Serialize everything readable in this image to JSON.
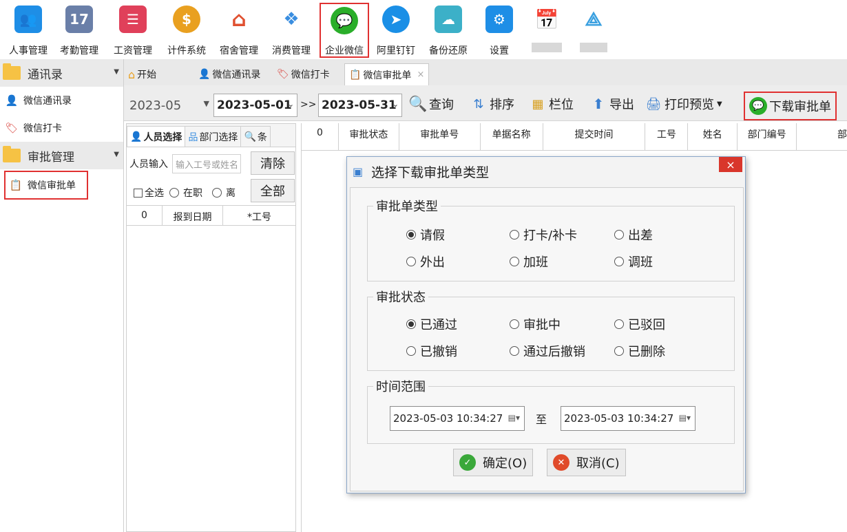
{
  "toolbar": {
    "items": [
      {
        "label": "人事管理",
        "icon": "people-icon",
        "color": "#1e8ee6"
      },
      {
        "label": "考勤管理",
        "icon": "calendar-icon",
        "color": "#6a7fa8"
      },
      {
        "label": "工资管理",
        "icon": "ledger-icon",
        "color": "#e0405a"
      },
      {
        "label": "计件系统",
        "icon": "money-bag-icon",
        "color": "#e9a020"
      },
      {
        "label": "宿舍管理",
        "icon": "house-gear-icon",
        "color": "#e05030"
      },
      {
        "label": "消费管理",
        "icon": "cubes-icon",
        "color": "#3a8ee0"
      },
      {
        "label": "企业微信",
        "icon": "wechat-icon",
        "color": "#2aae2a"
      },
      {
        "label": "阿里钉钉",
        "icon": "dingtalk-icon",
        "color": "#1a8fe6"
      },
      {
        "label": "备份还原",
        "icon": "cloud-icon",
        "color": "#3cb0c8"
      },
      {
        "label": "设置",
        "icon": "gear-icon",
        "color": "#1e8ee6"
      },
      {
        "label": "",
        "icon": "calendar-person-icon",
        "color": "#c43a3a"
      },
      {
        "label": "",
        "icon": "share-network-icon",
        "color": "#3aa0e0"
      }
    ]
  },
  "sidebar": {
    "groups": [
      {
        "label": "通讯录",
        "items": [
          {
            "label": "微信通讯录"
          },
          {
            "label": "微信打卡"
          }
        ]
      },
      {
        "label": "审批管理",
        "items": [
          {
            "label": "微信审批单"
          }
        ]
      }
    ]
  },
  "tabs": [
    {
      "label": "开始"
    },
    {
      "label": "微信通讯录"
    },
    {
      "label": "微信打卡"
    },
    {
      "label": "微信审批单",
      "close": "×"
    }
  ],
  "filter": {
    "month": "2023-05",
    "start_date": "2023-05-01",
    "range_sep": ">>",
    "end_date": "2023-05-31",
    "query": "查询",
    "sort": "排序",
    "columns": "栏位",
    "export": "导出",
    "print_preview": "打印预览",
    "download": "下载审批单"
  },
  "personnel": {
    "tabs": [
      "人员选择",
      "部门选择",
      "条"
    ],
    "input_label": "人员输入",
    "input_placeholder": "输入工号或姓名",
    "clear": "清除",
    "all_btn": "全部",
    "select_all": "全选",
    "status_active": "在职",
    "status_left": "离",
    "grid_headers": [
      "0",
      "报到日期",
      "*工号"
    ]
  },
  "grid": {
    "headers": [
      "0",
      "审批状态",
      "审批单号",
      "单据名称",
      "提交时间",
      "工号",
      "姓名",
      "部门编号",
      "部"
    ]
  },
  "dialog": {
    "title": "选择下载审批单类型",
    "close": "×",
    "type_group": "审批单类型",
    "types": [
      {
        "label": "请假",
        "checked": true
      },
      {
        "label": "打卡/补卡",
        "checked": false
      },
      {
        "label": "出差",
        "checked": false
      },
      {
        "label": "外出",
        "checked": false
      },
      {
        "label": "加班",
        "checked": false
      },
      {
        "label": "调班",
        "checked": false
      }
    ],
    "status_group": "审批状态",
    "statuses": [
      {
        "label": "已通过",
        "checked": true
      },
      {
        "label": "审批中",
        "checked": false
      },
      {
        "label": "已驳回",
        "checked": false
      },
      {
        "label": "已撤销",
        "checked": false
      },
      {
        "label": "通过后撤销",
        "checked": false
      },
      {
        "label": "已删除",
        "checked": false
      }
    ],
    "time_group": "时间范围",
    "time_from": "2023-05-03 10:34:27",
    "time_to_label": "至",
    "time_to": "2023-05-03 10:34:27",
    "ok": "确定(O)",
    "cancel": "取消(C)"
  }
}
